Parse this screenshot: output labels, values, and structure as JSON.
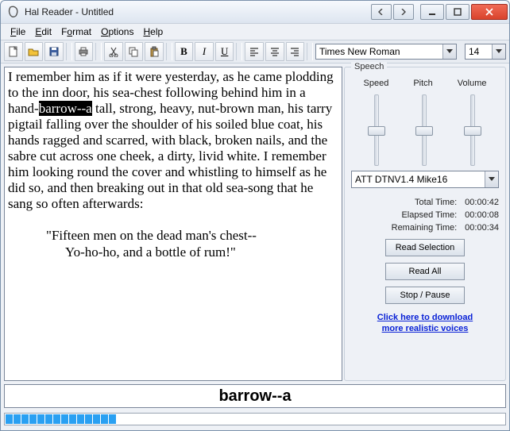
{
  "window": {
    "title": "Hal Reader - Untitled"
  },
  "menu": {
    "file": "File",
    "edit": "Edit",
    "format": "Format",
    "options": "Options",
    "help": "Help"
  },
  "toolbar": {
    "font_name": "Times New Roman",
    "font_size": "14"
  },
  "editor": {
    "p1_before": "I remember him as if it were yesterday, as he came plodding to the inn door, his sea-chest following behind him in a hand-",
    "p1_hl": "barrow--a",
    "p1_after": " tall, strong, heavy, nut-brown man, his tarry pigtail falling over the shoulder of his soiled blue coat, his hands ragged and scarred, with black, broken nails, and the sabre cut across one cheek, a dirty, livid white. I remember him looking round the cover and whistling to himself as he did so, and then breaking out in that old sea-song that he sang so often afterwards:",
    "quote_l1": "\"Fifteen men on the dead man's chest--",
    "quote_l2": "Yo-ho-ho, and a bottle of rum!\""
  },
  "speech": {
    "legend": "Speech",
    "speed_label": "Speed",
    "pitch_label": "Pitch",
    "volume_label": "Volume",
    "voice": "ATT DTNV1.4 Mike16",
    "total_label": "Total Time:",
    "total_val": "00:00:42",
    "elapsed_label": "Elapsed Time:",
    "elapsed_val": "00:00:08",
    "remaining_label": "Remaining Time:",
    "remaining_val": "00:00:34",
    "read_selection": "Read Selection",
    "read_all": "Read All",
    "stop_pause": "Stop / Pause",
    "download_l1": "Click here to download",
    "download_l2": "more realistic voices"
  },
  "wordbar": "barrow--a",
  "progress": {
    "segments": 14
  }
}
